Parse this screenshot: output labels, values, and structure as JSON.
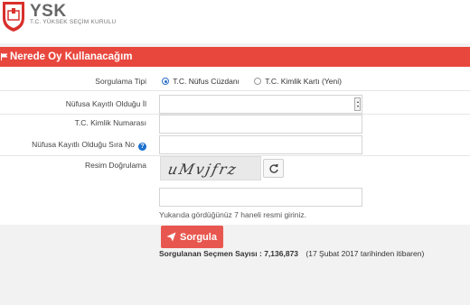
{
  "brand": {
    "title": "YSK",
    "subtitle": "T.C. YÜKSEK SEÇİM KURULU"
  },
  "panel": {
    "title": "Nerede Oy Kullanacağım"
  },
  "form": {
    "query_type_label": "Sorgulama Tipi",
    "option_1": "T.C. Nüfus Cüzdanı",
    "option_2": "T.C. Kimlik Kartı (Yeni)",
    "selected_option": "T.C. Nüfus Cüzdanı",
    "province_label": "Nüfusa Kayıtlı Olduğu İl",
    "province_value": "",
    "tc_label": "T.C. Kimlik Numarası",
    "tc_value": "",
    "sequence_label": "Nüfusa Kayıtlı Olduğu Sıra No",
    "captcha_label": "Resim Doğrulama",
    "captcha_text": "uMvjfrz",
    "captcha_value": "",
    "captcha_hint": "Yukarıda gördüğünüz 7 haneli resmi giriniz.",
    "submit_label": "Sorgula"
  },
  "stats": {
    "count_label": "Sorgulanan Seçmen Sayısı : 7,136,873",
    "count_note": "(17 Şubat 2017 tarihinden itibaren)"
  },
  "colors": {
    "accent": "#e8473d",
    "button": "#e8574f",
    "radio": "#2b6fc4",
    "help": "#1a6fcf"
  },
  "icons": {
    "flag": "flag-icon",
    "help": "question-circle-icon",
    "refresh": "refresh-icon",
    "submit": "paper-plane-icon"
  }
}
